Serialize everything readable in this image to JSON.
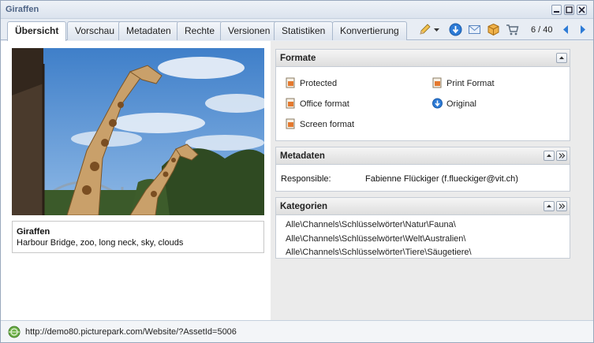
{
  "window": {
    "title": "Giraffen"
  },
  "tabs": [
    {
      "label": "Übersicht",
      "active": true
    },
    {
      "label": "Vorschau"
    },
    {
      "label": "Metadaten"
    },
    {
      "label": "Rechte"
    },
    {
      "label": "Versionen"
    },
    {
      "label": "Statistiken"
    },
    {
      "label": "Konvertierung"
    }
  ],
  "toolbar": {
    "icons": [
      "pencil-icon",
      "dropdown-arrow-icon",
      "download-icon",
      "mail-icon",
      "package-icon",
      "cart-icon"
    ],
    "pager": "6 / 40"
  },
  "asset": {
    "name": "Giraffen",
    "keywords": "Harbour Bridge, zoo, long neck, sky, clouds"
  },
  "formats": {
    "heading": "Formate",
    "items": [
      {
        "label": "Protected",
        "icon": "format-file-icon"
      },
      {
        "label": "Print Format",
        "icon": "format-file-icon"
      },
      {
        "label": "Office format",
        "icon": "format-file-icon"
      },
      {
        "label": "Original",
        "icon": "download-icon"
      },
      {
        "label": "Screen format",
        "icon": "format-file-icon"
      }
    ]
  },
  "metadata": {
    "heading": "Metadaten",
    "label": "Responsible:",
    "value": "Fabienne Flückiger (f.flueckiger@vit.ch)"
  },
  "categories": {
    "heading": "Kategorien",
    "items": [
      "Alle\\Channels\\Schlüsselwörter\\Natur\\Fauna\\",
      "Alle\\Channels\\Schlüsselwörter\\Welt\\Australien\\",
      "Alle\\Channels\\Schlüsselwörter\\Tiere\\Säugetiere\\"
    ]
  },
  "status": {
    "url": "http://demo80.picturepark.com/Website/?AssetId=5006"
  },
  "colors": {
    "title_text": "#4d6385",
    "accent_blue": "#2d7bd6"
  }
}
